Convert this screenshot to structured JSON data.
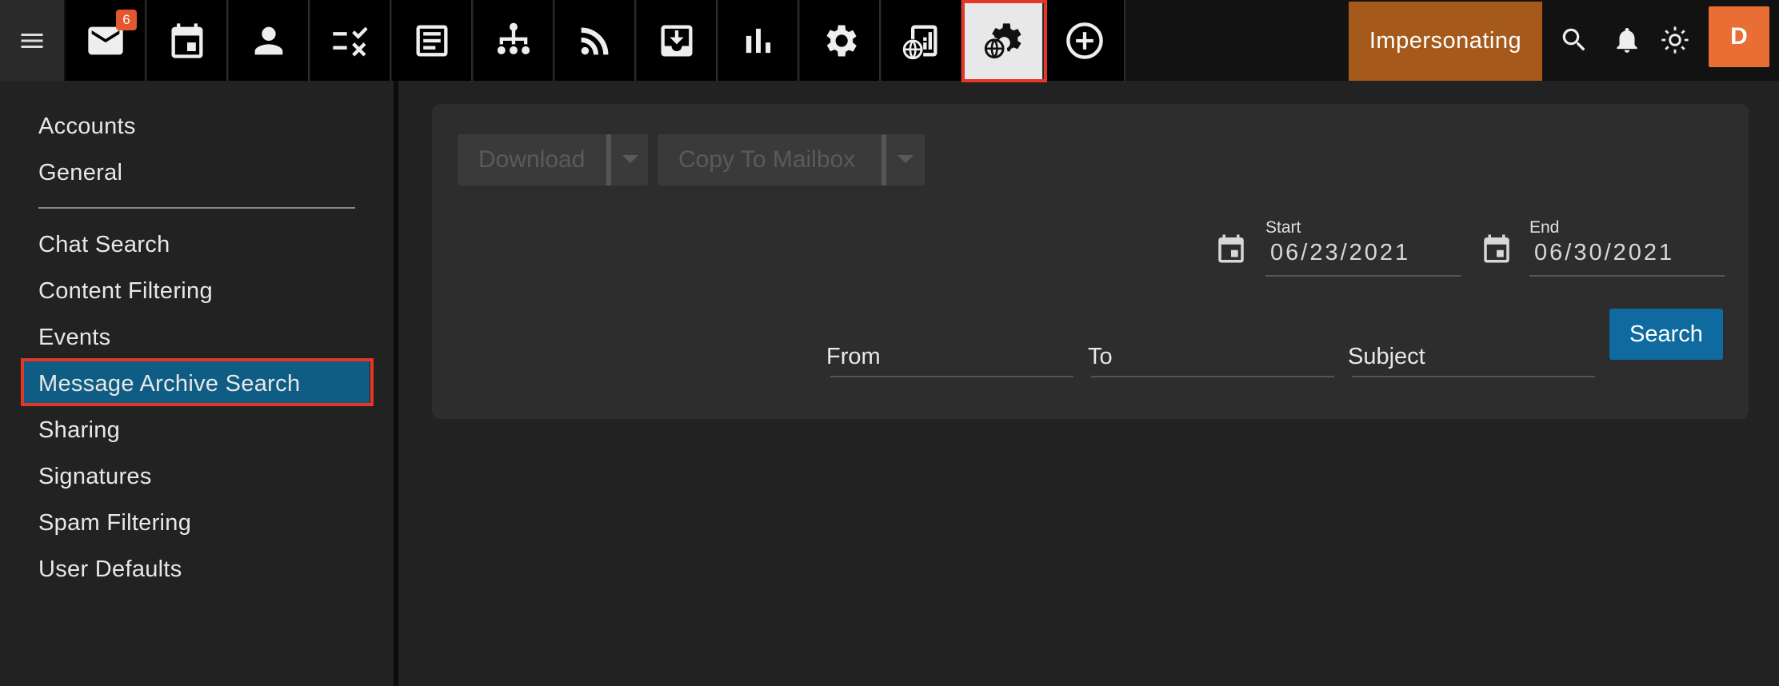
{
  "header": {
    "mail_badge": "6",
    "impersonating_label": "Impersonating",
    "avatar_initial": "D"
  },
  "sidebar": {
    "items": [
      {
        "label": "Accounts"
      },
      {
        "label": "General"
      },
      {
        "label": "Chat Search"
      },
      {
        "label": "Content Filtering"
      },
      {
        "label": "Events"
      },
      {
        "label": "Message Archive Search"
      },
      {
        "label": "Sharing"
      },
      {
        "label": "Signatures"
      },
      {
        "label": "Spam Filtering"
      },
      {
        "label": "User Defaults"
      }
    ],
    "active": "Message Archive Search"
  },
  "toolbar": {
    "download_label": "Download",
    "copy_label": "Copy To Mailbox"
  },
  "dates": {
    "start_label": "Start",
    "start_value": "06/23/2021",
    "end_label": "End",
    "end_value": "06/30/2021"
  },
  "filters": {
    "from_label": "From",
    "to_label": "To",
    "subject_label": "Subject",
    "search_label": "Search"
  },
  "colors": {
    "accent": "#0f5c84",
    "impersonating": "#a55a1b",
    "avatar": "#e86e33",
    "highlight": "#e53626",
    "search_button": "#0f6aa0"
  }
}
